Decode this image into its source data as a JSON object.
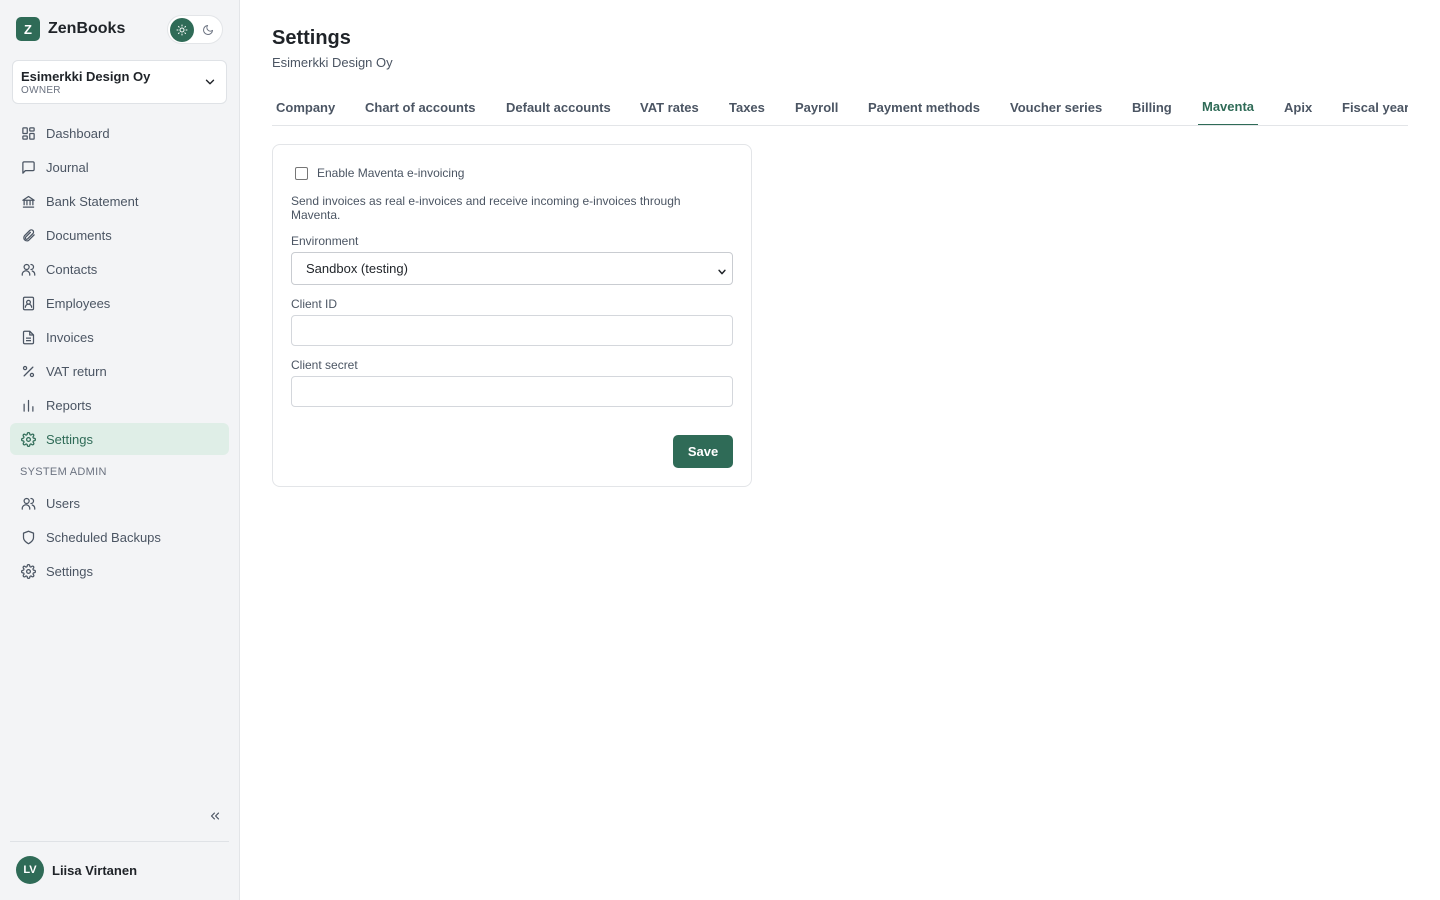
{
  "app": {
    "logo_letter": "Z",
    "name": "ZenBooks"
  },
  "theme": {
    "light_icon": "sun-icon",
    "dark_icon": "moon-icon",
    "active": "light"
  },
  "company": {
    "name": "Esimerkki Design Oy",
    "role": "OWNER"
  },
  "sidebar": {
    "items": [
      {
        "label": "Dashboard",
        "icon": "dashboard-icon"
      },
      {
        "label": "Journal",
        "icon": "chat-icon"
      },
      {
        "label": "Bank Statement",
        "icon": "bank-icon"
      },
      {
        "label": "Documents",
        "icon": "paperclip-icon"
      },
      {
        "label": "Contacts",
        "icon": "users-icon"
      },
      {
        "label": "Employees",
        "icon": "id-badge-icon"
      },
      {
        "label": "Invoices",
        "icon": "document-icon"
      },
      {
        "label": "VAT return",
        "icon": "percent-icon"
      },
      {
        "label": "Reports",
        "icon": "bar-chart-icon"
      },
      {
        "label": "Settings",
        "icon": "gear-icon",
        "active": true
      }
    ],
    "admin_section": "SYSTEM ADMIN",
    "admin_items": [
      {
        "label": "Users",
        "icon": "users-icon"
      },
      {
        "label": "Scheduled Backups",
        "icon": "shield-icon"
      },
      {
        "label": "Settings",
        "icon": "gear-icon"
      }
    ]
  },
  "user": {
    "initials": "LV",
    "name": "Liisa Virtanen"
  },
  "page": {
    "title": "Settings",
    "subtitle": "Esimerkki Design Oy"
  },
  "tabs": [
    "Company",
    "Chart of accounts",
    "Default accounts",
    "VAT rates",
    "Taxes",
    "Payroll",
    "Payment methods",
    "Voucher series",
    "Billing",
    "Maventa",
    "Apix",
    "Fiscal year"
  ],
  "active_tab": "Maventa",
  "maventa": {
    "enable_label": "Enable Maventa e-invoicing",
    "enabled": false,
    "description": "Send invoices as real e-invoices and receive incoming e-invoices through Maventa.",
    "environment_label": "Environment",
    "environment_value": "Sandbox (testing)",
    "client_id_label": "Client ID",
    "client_id_value": "",
    "client_secret_label": "Client secret",
    "client_secret_value": "",
    "save_label": "Save"
  },
  "colors": {
    "accent": "#2f6b57",
    "active_bg": "#dfeee7",
    "sidebar_bg": "#f3f4f6"
  }
}
